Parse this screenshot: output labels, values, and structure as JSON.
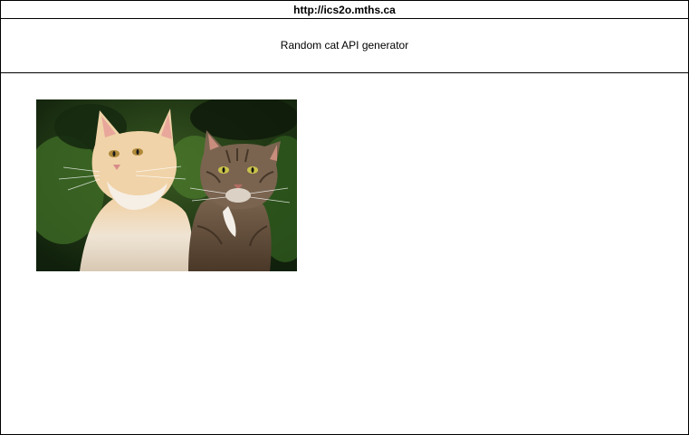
{
  "browser": {
    "url": "http://ics2o.mths.ca"
  },
  "page": {
    "title": "Random cat API generator"
  },
  "image": {
    "alt": "Two cats: a fluffy cream Maine Coon and a brown tabby cat",
    "background_color": "#1f3a18"
  }
}
